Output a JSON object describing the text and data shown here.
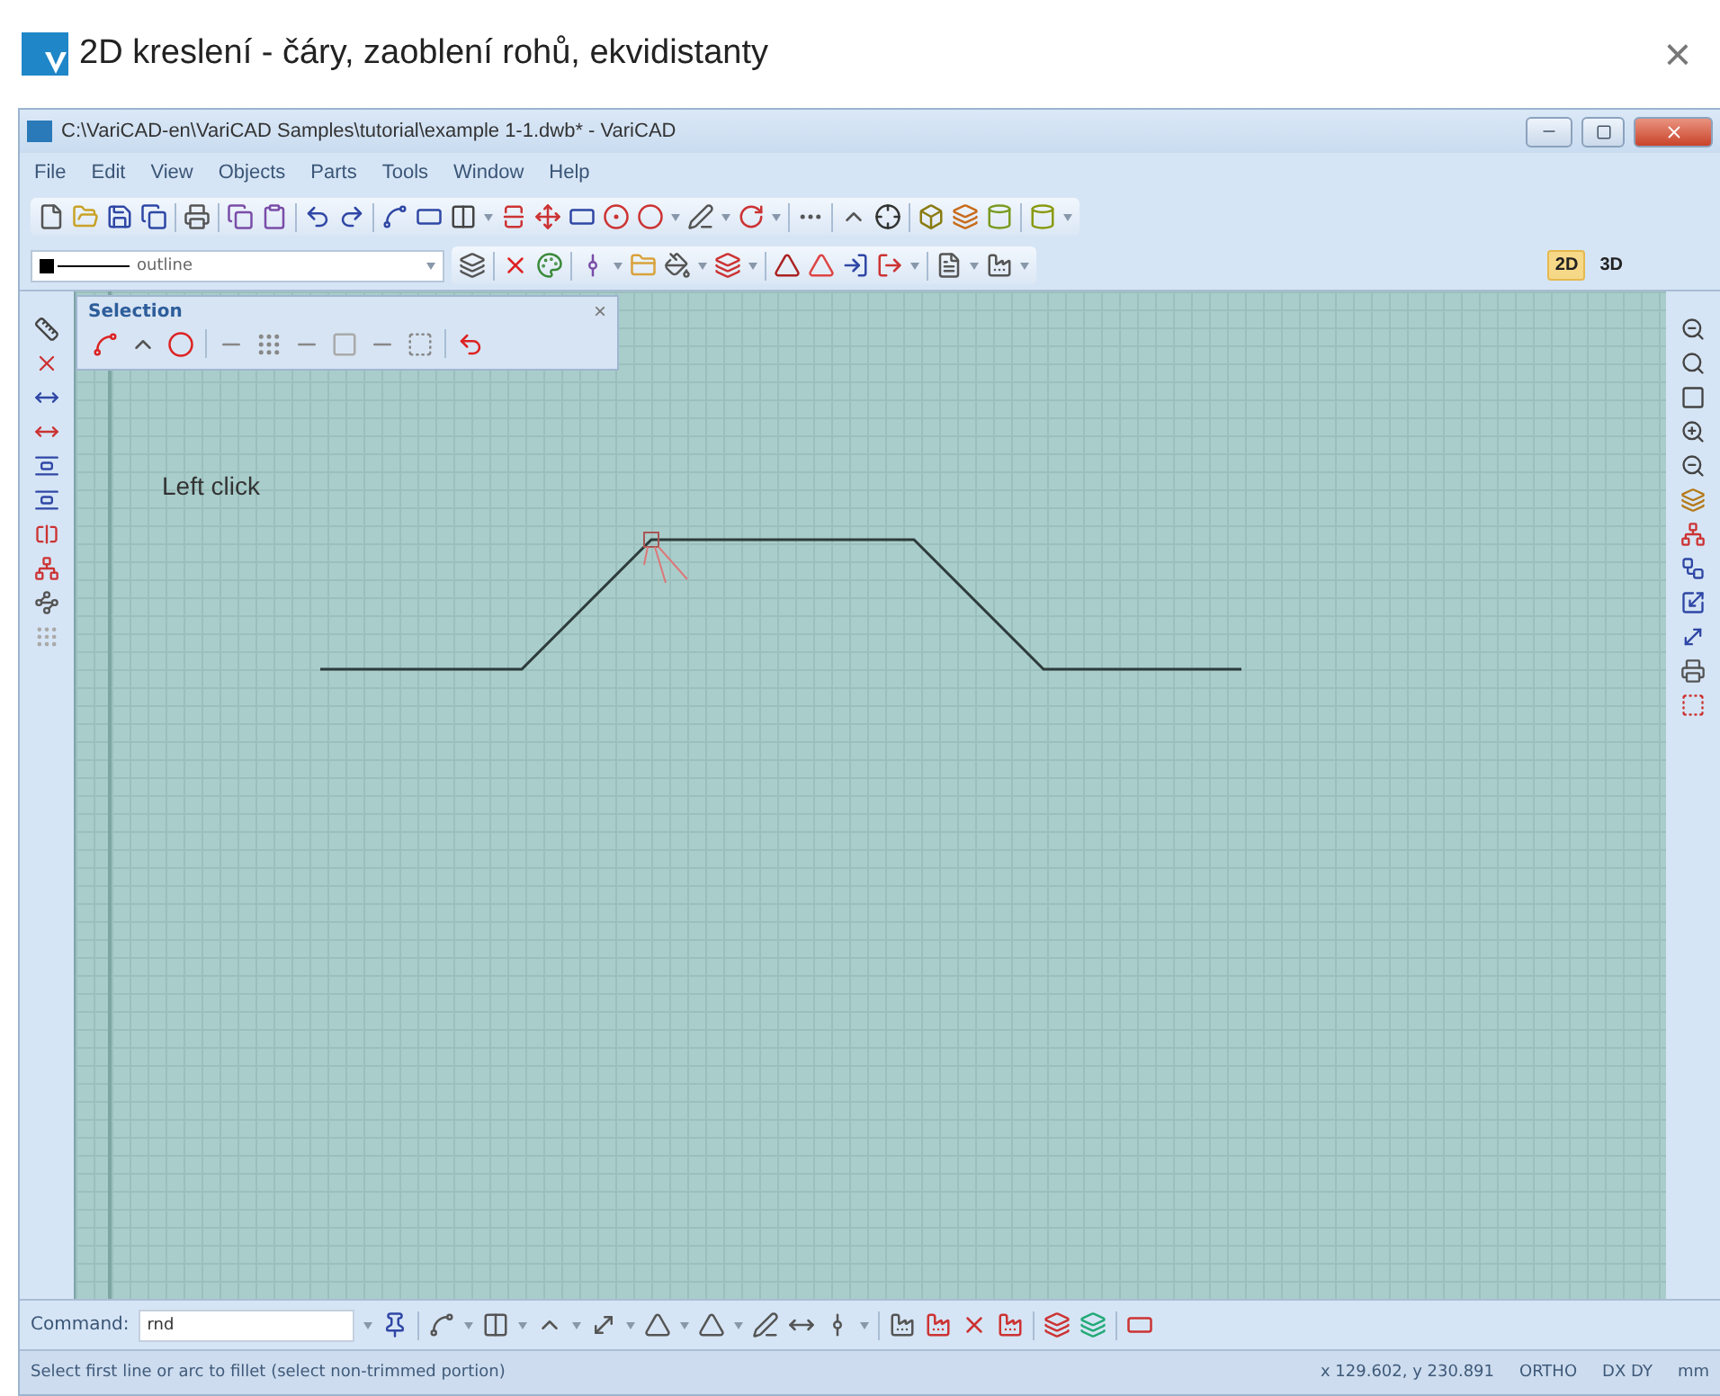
{
  "dialog": {
    "title": "2D kreslení - čáry, zaoblení rohů, ekvidistanty",
    "close": "×"
  },
  "window": {
    "title": "C:\\VariCAD-en\\VariCAD Samples\\tutorial\\example 1-1.dwb* - VariCAD"
  },
  "menu": [
    "File",
    "Edit",
    "View",
    "Objects",
    "Parts",
    "Tools",
    "Window",
    "Help"
  ],
  "line_style": {
    "value": "outline"
  },
  "view_modes": [
    {
      "label": "2D",
      "selected": true
    },
    {
      "label": "3D",
      "selected": false
    }
  ],
  "selection_panel": {
    "title": "Selection",
    "close": "×"
  },
  "canvas": {
    "label": "Left click"
  },
  "command": {
    "label": "Command:",
    "value": "rnd"
  },
  "status_bar": {
    "message": "Select first line or arc to fillet (select non-trimmed portion)",
    "coordinates": "x 129.602, y 230.891",
    "ortho": "ORTHO",
    "dxdy": "DX DY",
    "units": "mm"
  }
}
